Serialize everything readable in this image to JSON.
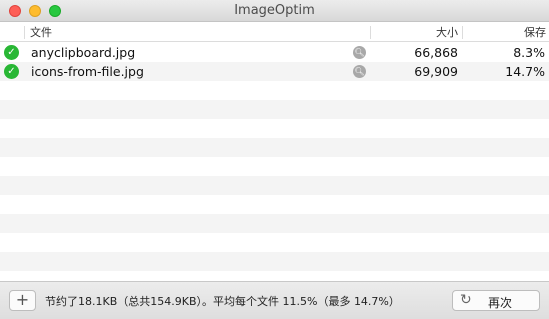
{
  "window": {
    "title": "ImageOptim"
  },
  "columns": {
    "file": "文件",
    "size": "大小",
    "saved": "保存"
  },
  "files": [
    {
      "name": "anyclipboard.jpg",
      "size": "66,868",
      "saved": "8.3%",
      "status_icon": "check-icon"
    },
    {
      "name": "icons-from-file.jpg",
      "size": "69,909",
      "saved": "14.7%",
      "status_icon": "check-icon"
    }
  ],
  "footer": {
    "add_label": "+",
    "status_text": "节约了18.1KB（总共154.9KB）。平均每个文件 11.5%（最多 14.7%）",
    "again_label": "再次",
    "again_icon": "refresh-icon"
  },
  "colors": {
    "check": "#29b735",
    "row_alt": "#f4f4f4"
  }
}
